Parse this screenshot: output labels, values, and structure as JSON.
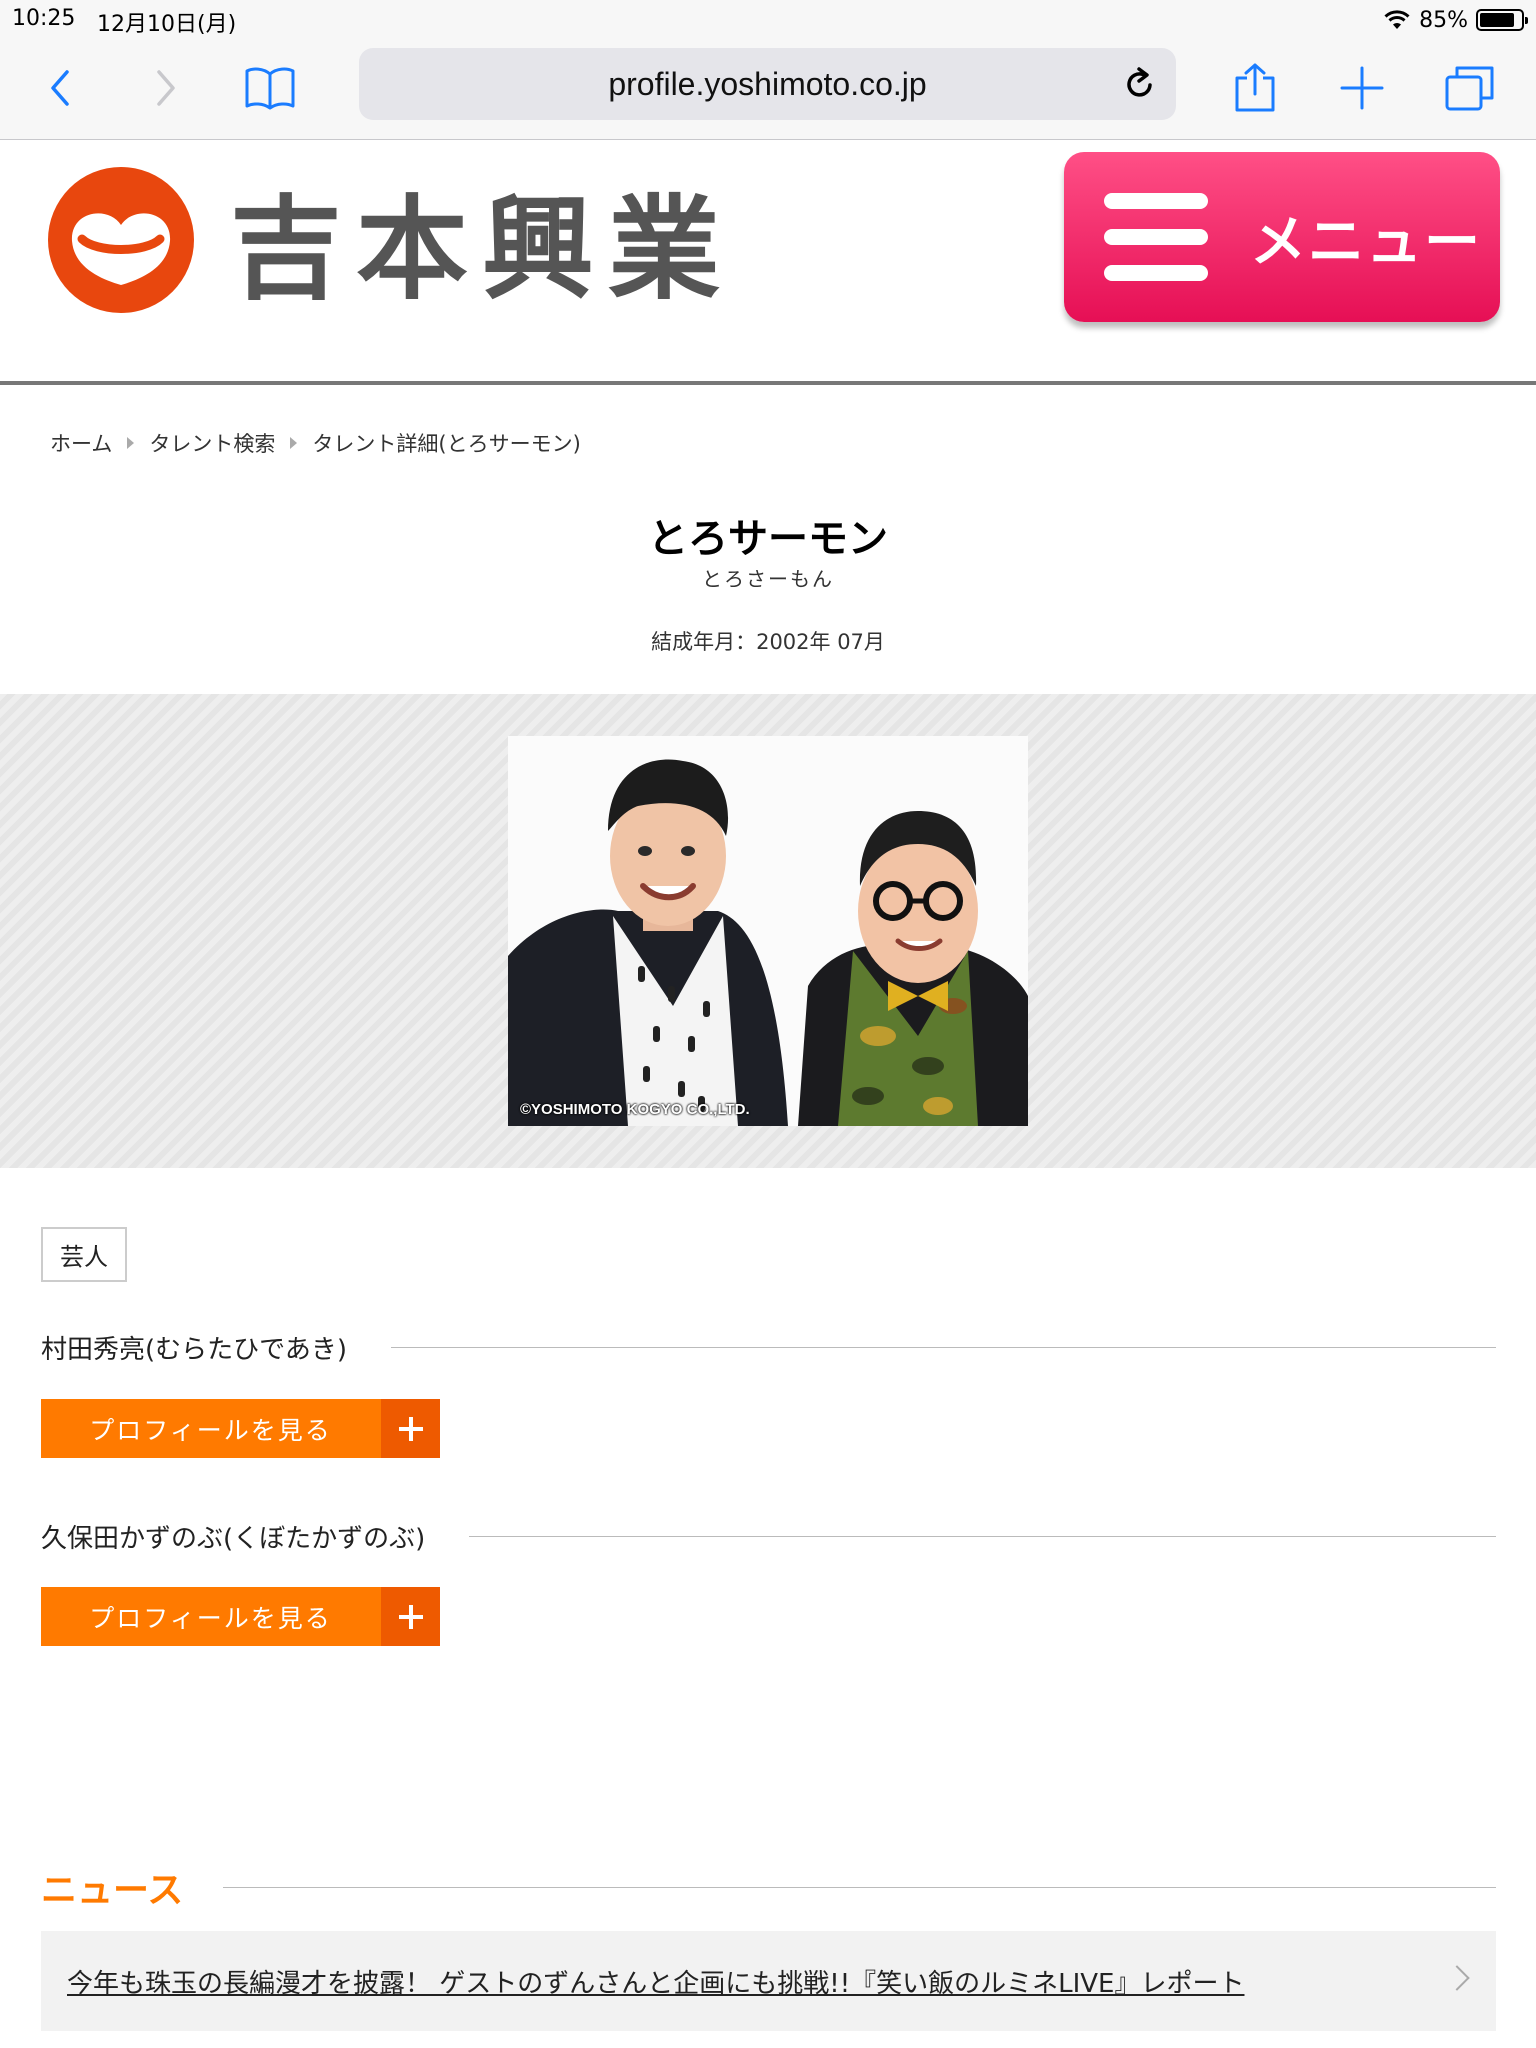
{
  "status_bar": {
    "time": "10:25",
    "date": "12月10日(月)",
    "battery": "85%",
    "battery_level": 0.85
  },
  "browser": {
    "url": "profile.yoshimoto.co.jp",
    "icons": [
      "back-icon",
      "forward-icon",
      "bookmarks-icon",
      "reload-icon",
      "share-icon",
      "new-tab-icon",
      "tabs-icon"
    ]
  },
  "site": {
    "logo_text": "吉本興業",
    "menu_label": "メニュー",
    "brand_color": "#e60f55",
    "logo_color": "#e8470e"
  },
  "breadcrumb": [
    "ホーム",
    "タレント検索",
    "タレント詳細(とろサーモン)"
  ],
  "talent": {
    "name": "とろサーモン",
    "kana": "とろさーもん",
    "formed": "結成年月：2002年 07月",
    "photo_copyright": "©YOSHIMOTO KOGYO CO.,LTD.",
    "category": "芸人"
  },
  "members": [
    {
      "name": "村田秀亮(むらたひであき)",
      "button": "プロフィールを見る"
    },
    {
      "name": "久保田かずのぶ(くぼたかずのぶ)",
      "button": "プロフィールを見る"
    }
  ],
  "news": {
    "heading": "ニュース",
    "accent_color": "#ff7a00",
    "items": [
      "今年も珠玉の長編漫才を披露！ ゲストのずんさんと企画にも挑戦!!『笑い飯のルミネLIVE』レポート"
    ]
  }
}
